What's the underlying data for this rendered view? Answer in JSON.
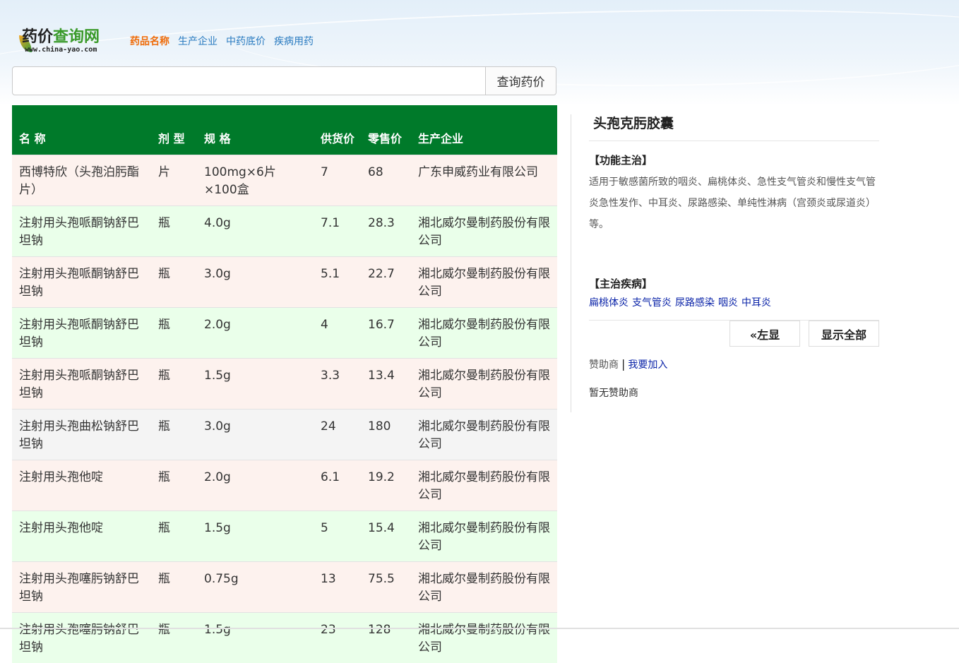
{
  "header": {
    "logo_title_a": "药价",
    "logo_title_b": "查询网",
    "logo_url": "www.china-yao.com",
    "nav": [
      {
        "label": "药品名称",
        "active": true
      },
      {
        "label": "生产企业",
        "active": false
      },
      {
        "label": "中药底价",
        "active": false
      },
      {
        "label": "疾病用药",
        "active": false
      }
    ]
  },
  "search": {
    "value": "",
    "button_label": "查询药价"
  },
  "table": {
    "headers": {
      "name": "名 称",
      "form": "剂 型",
      "spec": "规 格",
      "supply": "供货价",
      "retail": "零售价",
      "company": "生产企业"
    },
    "rows": [
      {
        "name": "西博特欣（头孢泊肟酯片）",
        "form": "片",
        "spec": "100mg×6片×100盒",
        "supply": "7",
        "retail": "68",
        "company": "广东申威药业有限公司"
      },
      {
        "name": "注射用头孢哌酮钠舒巴坦钠",
        "form": "瓶",
        "spec": "4.0g",
        "supply": "7.1",
        "retail": "28.3",
        "company": "湘北威尔曼制药股份有限公司"
      },
      {
        "name": "注射用头孢哌酮钠舒巴坦钠",
        "form": "瓶",
        "spec": "3.0g",
        "supply": "5.1",
        "retail": "22.7",
        "company": "湘北威尔曼制药股份有限公司"
      },
      {
        "name": "注射用头孢哌酮钠舒巴坦钠",
        "form": "瓶",
        "spec": "2.0g",
        "supply": "4",
        "retail": "16.7",
        "company": "湘北威尔曼制药股份有限公司"
      },
      {
        "name": "注射用头孢哌酮钠舒巴坦钠",
        "form": "瓶",
        "spec": "1.5g",
        "supply": "3.3",
        "retail": "13.4",
        "company": "湘北威尔曼制药股份有限公司"
      },
      {
        "name": "注射用头孢曲松钠舒巴坦钠",
        "form": "瓶",
        "spec": "3.0g",
        "supply": "24",
        "retail": "180",
        "company": "湘北威尔曼制药股份有限公司"
      },
      {
        "name": "注射用头孢他啶",
        "form": "瓶",
        "spec": "2.0g",
        "supply": "6.1",
        "retail": "19.2",
        "company": "湘北威尔曼制药股份有限公司"
      },
      {
        "name": "注射用头孢他啶",
        "form": "瓶",
        "spec": "1.5g",
        "supply": "5",
        "retail": "15.4",
        "company": "湘北威尔曼制药股份有限公司"
      },
      {
        "name": "注射用头孢噻肟钠舒巴坦钠",
        "form": "瓶",
        "spec": "0.75g",
        "supply": "13",
        "retail": "75.5",
        "company": "湘北威尔曼制药股份有限公司"
      },
      {
        "name": "注射用头孢噻肟钠舒巴坦钠",
        "form": "瓶",
        "spec": "1.5g",
        "supply": "23",
        "retail": "128",
        "company": "湘北威尔曼制药股份有限公司"
      }
    ]
  },
  "side": {
    "title": "头孢克肟胶囊",
    "function_title": "【功能主治】",
    "function_text": "适用于敏感菌所致的咽炎、扁桃体炎、急性支气管炎和慢性支气管炎急性发作、中耳炎、尿路感染、单纯性淋病（宫颈炎或尿道炎）等。",
    "disease_title": "【主治疾病】",
    "diseases": [
      "扁桃体炎",
      "支气管炎",
      "尿路感染",
      "咽炎",
      "中耳炎"
    ],
    "left_button": "«左显",
    "show_all_button": "显示全部",
    "sponsor_label": "赞助商",
    "sponsor_sep": "|",
    "join_link": "我要加入",
    "no_sponsor": "暂无赞助商"
  }
}
